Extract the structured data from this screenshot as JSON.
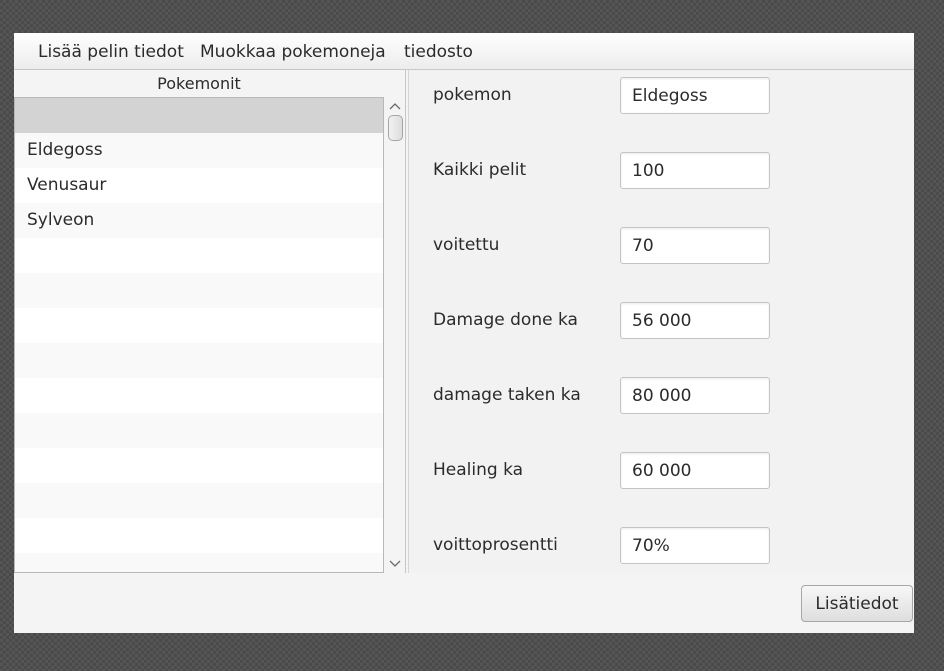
{
  "menubar": {
    "items": [
      "Lisää pelin tiedot",
      "Muokkaa pokemoneja",
      "tiedosto"
    ]
  },
  "list": {
    "header": "Pokemonit",
    "selected_index": 0,
    "items": [
      "",
      "Eldegoss",
      "Venusaur",
      "Sylveon"
    ]
  },
  "form": {
    "fields": [
      {
        "label": "pokemon",
        "value": "Eldegoss"
      },
      {
        "label": "Kaikki pelit",
        "value": "100"
      },
      {
        "label": "voitettu",
        "value": "70"
      },
      {
        "label": "Damage done ka",
        "value": "56 000"
      },
      {
        "label": "damage taken ka",
        "value": "80 000"
      },
      {
        "label": "Healing ka",
        "value": "60 000"
      },
      {
        "label": "voittoprosentti",
        "value": "70%"
      }
    ]
  },
  "footer": {
    "details_button": "Lisätiedot"
  },
  "icons": {
    "scroll_up": "chevron-up-icon",
    "scroll_down": "chevron-down-icon"
  }
}
